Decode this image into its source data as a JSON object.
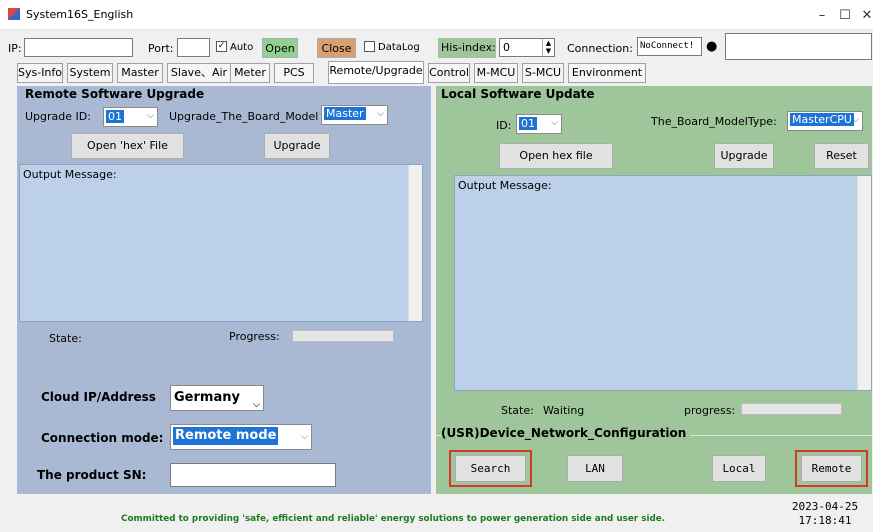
{
  "window": {
    "title": "System16S_English",
    "min": "–",
    "max": "☐",
    "close": "✕"
  },
  "toolbar": {
    "ip_label": "IP:",
    "ip_value": "",
    "port_label": "Port:",
    "port_value": "",
    "auto_label": "Auto",
    "open_label": "Open",
    "close_label": "Close",
    "datalog_label": "DataLog",
    "his_index_label": "His-index:",
    "his_index_value": "0",
    "connection_label": "Connection:",
    "connection_value": "NoConnect!",
    "status_dot": "●",
    "colors": {
      "open_bg": "#90d090",
      "close_bg": "#d8a070",
      "his_bg": "#9fc59b"
    }
  },
  "tabs": [
    "Sys-Info",
    "System",
    "Master",
    "Slave、Air",
    "Meter",
    "PCS",
    "Remote/Upgrade",
    "Control",
    "M-MCU",
    "S-MCU",
    "Environment"
  ],
  "active_tab": "Remote/Upgrade",
  "remote": {
    "title": "Remote Software Upgrade",
    "upgrade_id_label": "Upgrade ID:",
    "upgrade_id_value": "01",
    "board_model_label": "Upgrade_The_Board_Model",
    "board_model_value": "Master",
    "open_hex_label": "Open 'hex' File",
    "upgrade_label": "Upgrade",
    "output_label": "Output Message:",
    "state_label": "State:",
    "progress_label": "Progress:",
    "cloud_label": "Cloud IP/Address",
    "cloud_value": "Germany",
    "conn_mode_label": "Connection mode:",
    "conn_mode_value": "Remote mode",
    "sn_label": "The product SN:",
    "sn_value": ""
  },
  "local": {
    "title": "Local Software Update",
    "id_label": "ID:",
    "id_value": "01",
    "board_type_label": "The_Board_ModelType:",
    "board_type_value": "MasterCPU",
    "open_hex_label": "Open hex file",
    "upgrade_label": "Upgrade",
    "reset_label": "Reset",
    "output_label": "Output Message:",
    "state_label": "State:",
    "state_value": "Waiting",
    "progress_label": "progress:",
    "net_title": "(USR)Device_Network_Configuration",
    "search_label": "Search",
    "lan_label": "LAN",
    "local_label": "Local",
    "remote_label": "Remote"
  },
  "footer": {
    "slogan": "Committed to providing 'safe, efficient and reliable' energy solutions to power generation side and user side.",
    "date": "2023-04-25",
    "time": "17:18:41",
    "slogan_color": "#1f7a1f"
  }
}
